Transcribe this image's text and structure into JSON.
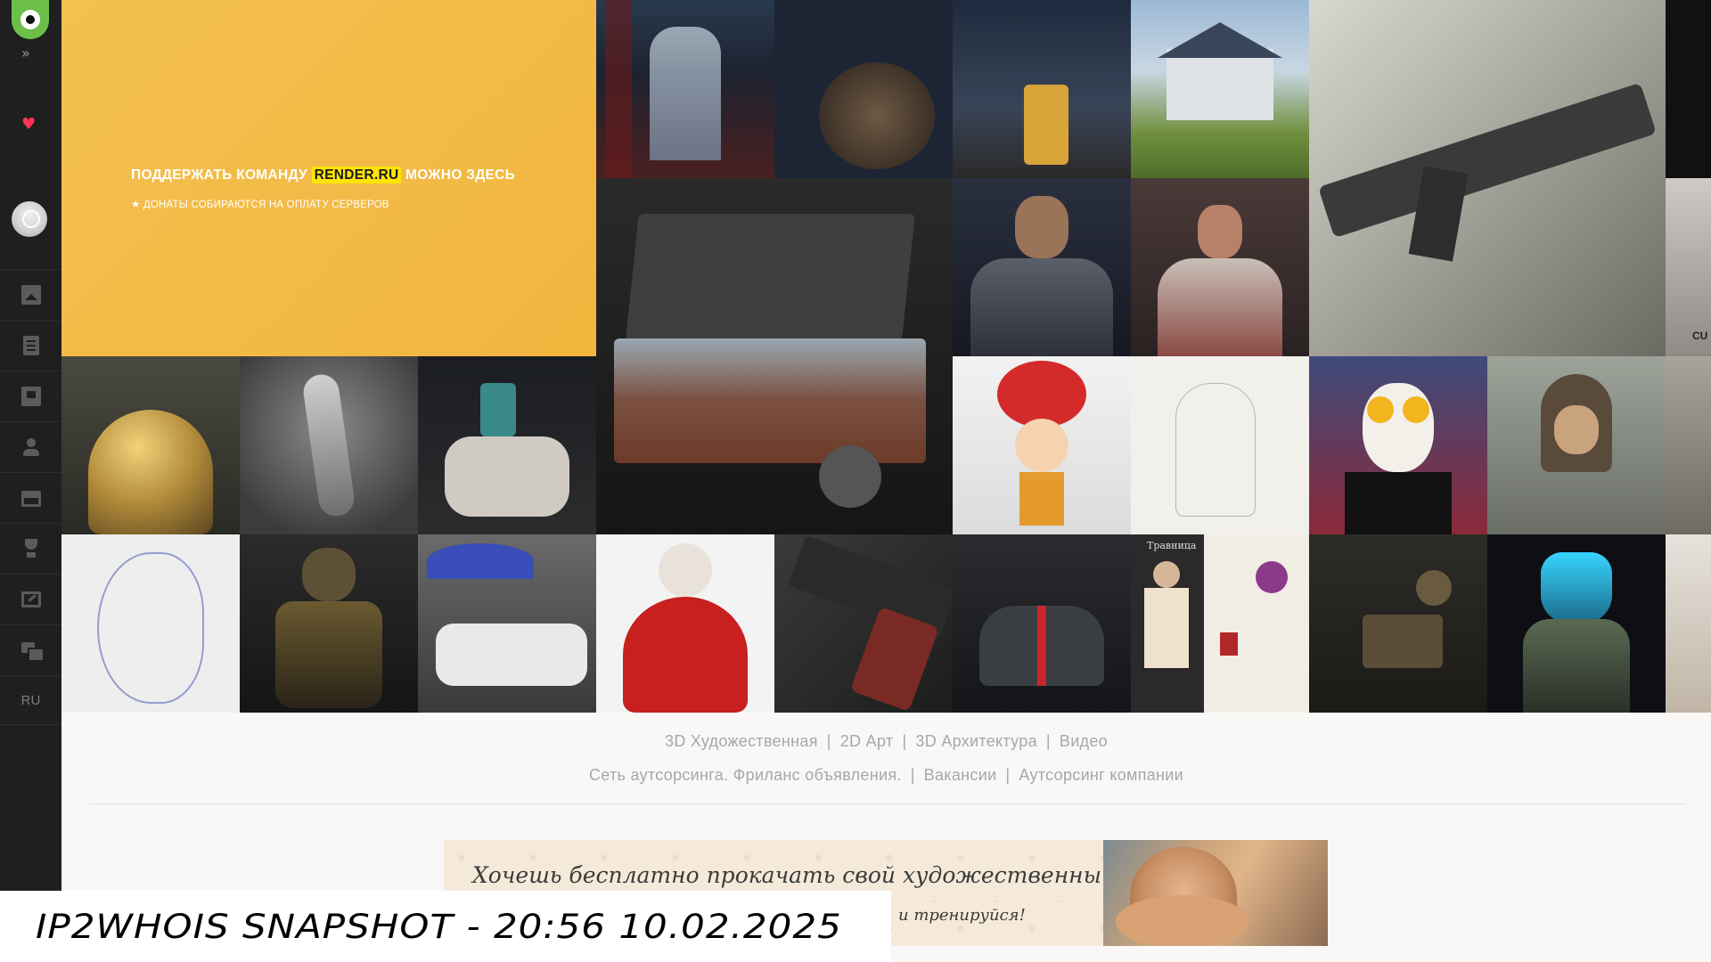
{
  "sidebar": {
    "logo": "render-logo",
    "expand_icon": "»",
    "favorite_icon": "♥",
    "lang": "RU",
    "items": [
      {
        "name": "gallery",
        "icon": "image-icon"
      },
      {
        "name": "articles",
        "icon": "document-icon"
      },
      {
        "name": "lessons",
        "icon": "book-icon"
      },
      {
        "name": "people",
        "icon": "person-icon"
      },
      {
        "name": "video",
        "icon": "film-icon"
      },
      {
        "name": "contests",
        "icon": "trophy-icon"
      },
      {
        "name": "portfolio",
        "icon": "screen-icon"
      },
      {
        "name": "forum",
        "icon": "chat-icon"
      }
    ]
  },
  "donate": {
    "title_prefix": "ПОДДЕРЖАТЬ КОМАНДУ ",
    "brand": "RENDER.RU",
    "title_suffix": " МОЖНО ЗДЕСЬ",
    "note": "★ ДОНАТЫ СОБИРАЮТСЯ НА ОПЛАТУ СЕРВЕРОВ",
    "bg_color": "#f2b83f"
  },
  "gallery": [
    {
      "name": "scifi-corridor",
      "label": ""
    },
    {
      "name": "dining-table",
      "label": ""
    },
    {
      "name": "tram-street",
      "label": ""
    },
    {
      "name": "country-house",
      "label": ""
    },
    {
      "name": "rifle-on-cloth",
      "label": ""
    },
    {
      "name": "edge-dark",
      "label": ""
    },
    {
      "name": "vintage-suitcase",
      "label": ""
    },
    {
      "name": "armored-knight",
      "label": ""
    },
    {
      "name": "desert-warrior",
      "label": ""
    },
    {
      "name": "edge-poster",
      "label": "CU"
    },
    {
      "name": "golden-dome",
      "label": ""
    },
    {
      "name": "dancer",
      "label": ""
    },
    {
      "name": "horse-battle",
      "label": ""
    },
    {
      "name": "mushroom-character",
      "label": ""
    },
    {
      "name": "pencil-sketch",
      "label": ""
    },
    {
      "name": "clown-portrait",
      "label": ""
    },
    {
      "name": "hooded-figure",
      "label": ""
    },
    {
      "name": "edge-figure",
      "label": ""
    },
    {
      "name": "ink-mermaid",
      "label": ""
    },
    {
      "name": "robot-soldier",
      "label": ""
    },
    {
      "name": "muscle-car",
      "label": ""
    },
    {
      "name": "red-dress-lady",
      "label": ""
    },
    {
      "name": "pistol",
      "label": ""
    },
    {
      "name": "sports-car",
      "label": ""
    },
    {
      "name": "herbal-book",
      "label": "Травница"
    },
    {
      "name": "workshop-scene",
      "label": ""
    },
    {
      "name": "ice-knight",
      "label": ""
    },
    {
      "name": "edge-room",
      "label": ""
    }
  ],
  "links_row1": [
    "3D Художественная",
    "2D Арт",
    "3D Архитектура",
    "Видео"
  ],
  "links_row2": [
    "Сеть аутсорсинга. Фриланс объявления.",
    "Вакансии",
    "Аутсорсинг компании"
  ],
  "link_separator": "|",
  "ad": {
    "heading": "Хочешь бесплатно прокачать свой художественный скилл?",
    "subtext": "и тренируйся!"
  },
  "watermark": "IP2WHOIS SNAPSHOT - 20:56 10.02.2025"
}
